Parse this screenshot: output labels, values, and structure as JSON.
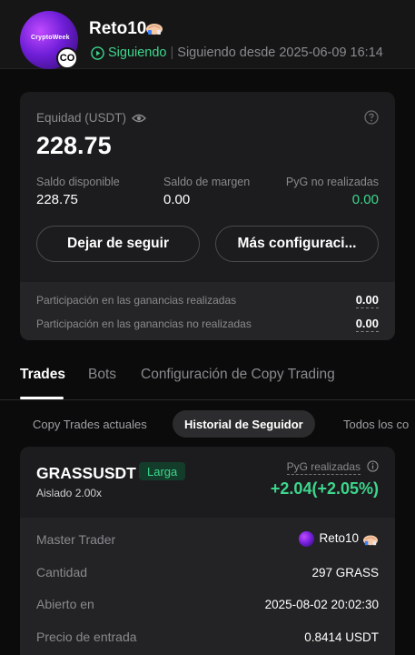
{
  "header": {
    "avatar_text": "CryptoWeek",
    "avatar_badge": "CO",
    "trader_name": "Reto10",
    "status_following": "Siguiendo",
    "status_separator": "|",
    "status_since": "Siguiendo desde 2025-06-09 16:14",
    "emoji_icon": "handshake-emoji-icon"
  },
  "equity_card": {
    "equity_label": "Equidad (USDT)",
    "equity_value": "228.75",
    "available_label": "Saldo disponible",
    "available_value": "228.75",
    "margin_label": "Saldo de margen",
    "margin_value": "0.00",
    "unrealized_label": "PyG no realizadas",
    "unrealized_value": "0.00",
    "unfollow_button": "Dejar de seguir",
    "more_settings_button": "Más configuraci...",
    "realized_share_label": "Participación en las ganancias realizadas",
    "realized_share_value": "0.00",
    "unrealized_share_label": "Participación en las ganancias no realizadas",
    "unrealized_share_value": "0.00"
  },
  "tabs": [
    {
      "label": "Trades",
      "active": true
    },
    {
      "label": "Bots",
      "active": false
    },
    {
      "label": "Configuración de Copy Trading",
      "active": false
    }
  ],
  "subtabs": [
    {
      "label": "Copy Trades actuales",
      "active": false
    },
    {
      "label": "Historial de Seguidor",
      "active": true
    },
    {
      "label": "Todos los co",
      "active": false
    }
  ],
  "position": {
    "symbol": "GRASSUSDT",
    "side": "Larga",
    "margin_mode": "Aislado 2.00x",
    "pnl_label": "PyG realizadas",
    "pnl_value": "+2.04(+2.05%)",
    "rows": [
      {
        "label": "Master Trader",
        "value": "Reto10"
      },
      {
        "label": "Cantidad",
        "value": "297 GRASS"
      },
      {
        "label": "Abierto en",
        "value": "2025-08-02 20:02:30"
      },
      {
        "label": "Precio de entrada",
        "value": "0.8414 USDT"
      }
    ]
  },
  "colors": {
    "background": "#0b0b0c",
    "card": "#1c1c1e",
    "accent_green": "#3dd68c",
    "muted_text": "#8a8a8e"
  }
}
